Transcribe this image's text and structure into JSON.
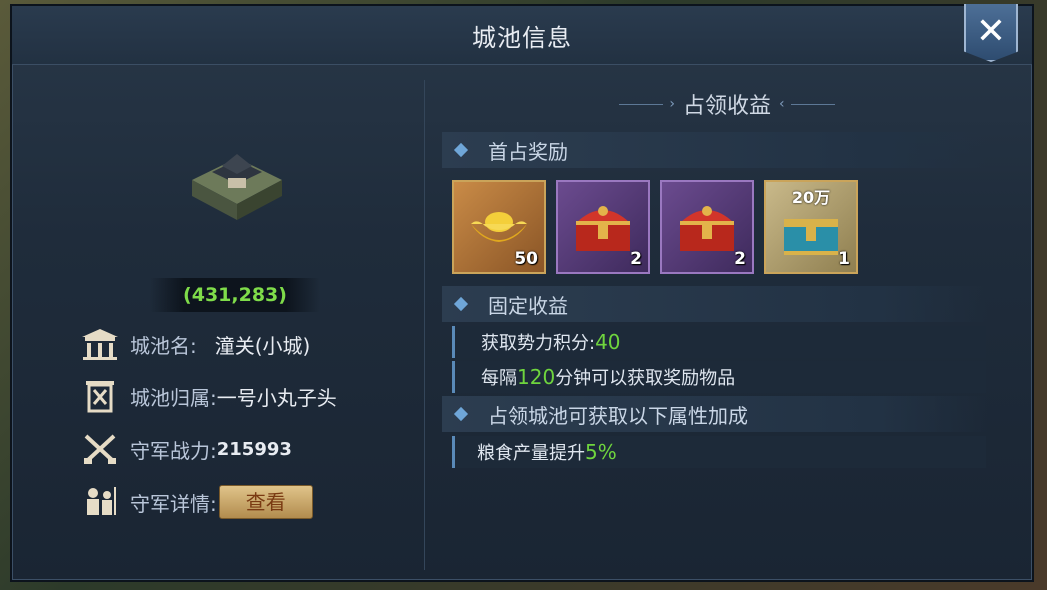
{
  "window": {
    "title": "城池信息",
    "close_icon": "close-icon"
  },
  "city": {
    "coords": "(431,283)",
    "name_label": "城池名:",
    "name_value": "潼关(小城)",
    "owner_label": "城池归属:",
    "owner_value": "一号小丸子头",
    "power_label": "守军战力:",
    "power_value": "215993",
    "detail_label": "守军详情:",
    "view_button": "查看"
  },
  "rewards": {
    "section_title": "占领收益",
    "first_title": "首占奖励",
    "items": [
      {
        "icon": "gold-ingot-icon",
        "qty": "50",
        "top_label": ""
      },
      {
        "icon": "red-chest-icon",
        "qty": "2",
        "top_label": ""
      },
      {
        "icon": "red-chest-icon",
        "qty": "2",
        "top_label": ""
      },
      {
        "icon": "blue-chest-icon",
        "qty": "1",
        "top_label": "20万"
      }
    ],
    "fixed_title": "固定收益",
    "fixed_rows": [
      {
        "prefix": "获取势力积分:",
        "value": "40",
        "suffix": ""
      },
      {
        "prefix": "每隔",
        "value": "120",
        "suffix": "分钟可以获取奖励物品"
      }
    ],
    "attr_title": "占领城池可获取以下属性加成",
    "attr_rows": [
      {
        "prefix": "粮食产量提升",
        "value": "5%",
        "suffix": ""
      }
    ]
  }
}
